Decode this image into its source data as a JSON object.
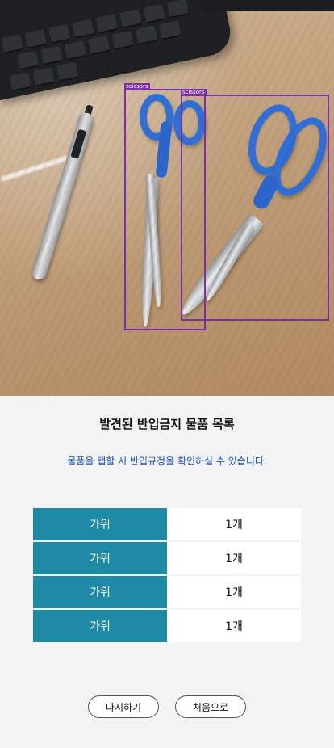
{
  "detections": [
    {
      "label": "scissors"
    },
    {
      "label": "scissors"
    }
  ],
  "header": {
    "title": "발견된 반입금지 물품 목록",
    "subtitle": "물품을 탭할 시 반입규정을 확인하실 수 있습니다."
  },
  "items": [
    {
      "name": "가위",
      "count": "1개"
    },
    {
      "name": "가위",
      "count": "1개"
    },
    {
      "name": "가위",
      "count": "1개"
    },
    {
      "name": "가위",
      "count": "1개"
    }
  ],
  "buttons": {
    "retry": "다시하기",
    "home": "처음으로"
  },
  "colors": {
    "accent_cell": "#1f8aa6",
    "subtitle_text": "#1b55b8",
    "detection_box": "#7b2fa3",
    "background": "#f3f3f3"
  }
}
